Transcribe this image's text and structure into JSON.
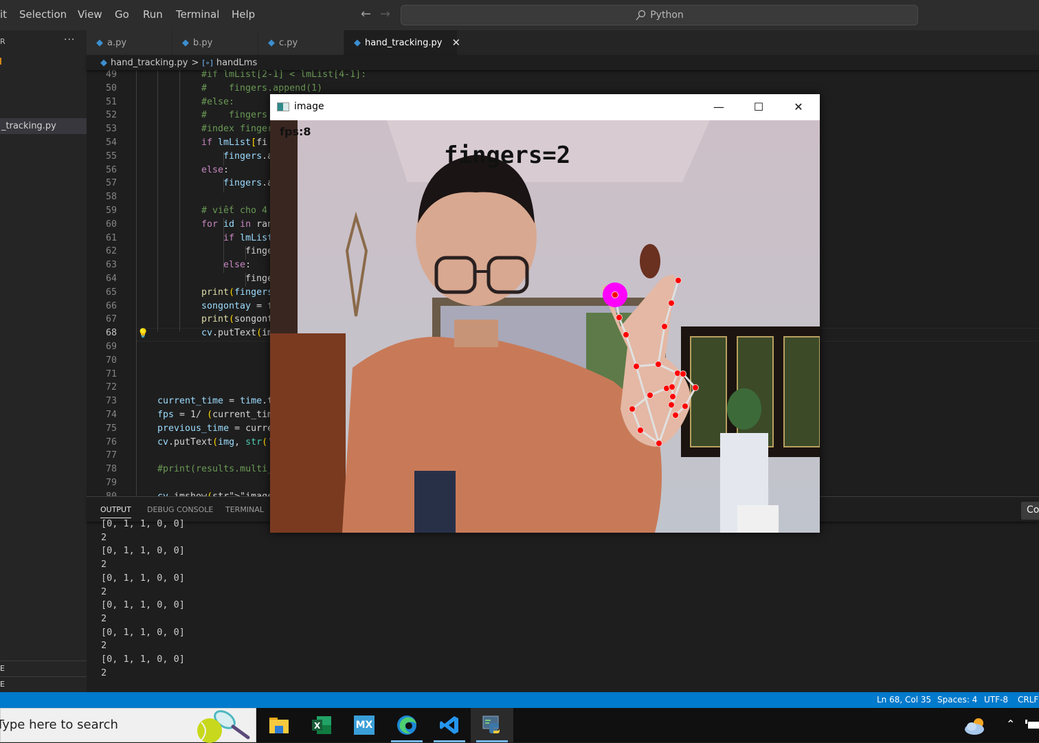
{
  "menu": {
    "items": [
      "it",
      "Selection",
      "View",
      "Go",
      "Run",
      "Terminal",
      "Help"
    ],
    "command_center": "Python"
  },
  "sidebar": {
    "header": "R",
    "more": "···",
    "active_file": "_tracking.py",
    "sections": [
      "E",
      "E"
    ]
  },
  "tabs": [
    {
      "label": "a.py",
      "active": false
    },
    {
      "label": "b.py",
      "active": false
    },
    {
      "label": "c.py",
      "active": false
    },
    {
      "label": "hand_tracking.py",
      "active": true
    }
  ],
  "tab_close": "✕",
  "breadcrumb": {
    "file": "hand_tracking.py",
    "separator": ">",
    "symbol_icon": "[∘]",
    "symbol": "handLms"
  },
  "editor": {
    "current_line": 68,
    "lines": [
      {
        "n": "49",
        "t": "#if lmList[2-1] < lmList[4-1]:"
      },
      {
        "n": "50",
        "t": "#    fingers.append(1)"
      },
      {
        "n": "51",
        "t": "#else:"
      },
      {
        "n": "52",
        "t": "#    fingers"
      },
      {
        "n": "53",
        "t": "#index finger"
      },
      {
        "n": "54",
        "t": "if lmList[fi"
      },
      {
        "n": "55",
        "t": "    fingers.a"
      },
      {
        "n": "56",
        "t": "else:"
      },
      {
        "n": "57",
        "t": "    fingers.a"
      },
      {
        "n": "58",
        "t": ""
      },
      {
        "n": "59",
        "t": "# viết cho 4"
      },
      {
        "n": "60",
        "t": "for id in ran"
      },
      {
        "n": "61",
        "t": "    if lmList"
      },
      {
        "n": "62",
        "t": "        finge"
      },
      {
        "n": "63",
        "t": "    else:"
      },
      {
        "n": "64",
        "t": "        finge"
      },
      {
        "n": "65",
        "t": "print(fingers"
      },
      {
        "n": "66",
        "t": "songontay = f"
      },
      {
        "n": "67",
        "t": "print(songont"
      },
      {
        "n": "68",
        "t": "cv.putText(im"
      },
      {
        "n": "69",
        "t": ""
      },
      {
        "n": "70",
        "t": ""
      },
      {
        "n": "71",
        "t": ""
      },
      {
        "n": "72",
        "t": ""
      },
      {
        "n": "73",
        "t": "current_time = time.t"
      },
      {
        "n": "74",
        "t": "fps = 1/ (current_tim"
      },
      {
        "n": "75",
        "t": "previous_time = curre"
      },
      {
        "n": "76",
        "t": "cv.putText(img, str('"
      },
      {
        "n": "77",
        "t": ""
      },
      {
        "n": "78",
        "t": "#print(results.multi_"
      },
      {
        "n": "79",
        "t": ""
      },
      {
        "n": "80",
        "t": "cv.imshow(\"image\", im"
      }
    ]
  },
  "panel": {
    "tabs": [
      "OUTPUT",
      "DEBUG CONSOLE",
      "TERMINAL"
    ],
    "active_tab": "OUTPUT",
    "dropdown": "Co",
    "output_lines": [
      "[0, 1, 1, 0, 0]",
      "2",
      "[0, 1, 1, 0, 0]",
      "2",
      "[0, 1, 1, 0, 0]",
      "2",
      "[0, 1, 1, 0, 0]",
      "2",
      "[0, 1, 1, 0, 0]",
      "2",
      "[0, 1, 1, 0, 0]",
      "2"
    ]
  },
  "statusbar": {
    "position": "Ln 68, Col 35",
    "spaces": "Spaces: 4",
    "encoding": "UTF-8",
    "eol": "CRLF"
  },
  "taskbar": {
    "search_placeholder": "Type here to search",
    "apps": [
      "file-explorer",
      "excel",
      "mx",
      "edge",
      "vscode",
      "python"
    ],
    "mx_label": "MX"
  },
  "cv_window": {
    "title": "image",
    "minimize": "—",
    "maximize": "☐",
    "close": "✕",
    "fps_text": "fps:8",
    "fingers_text": "fingers=2",
    "finger_states": [
      0,
      1,
      1,
      0,
      0
    ],
    "finger_count": 2
  },
  "colors": {
    "accent": "#007acc",
    "landmark": "#ff0000",
    "highlight": "#ff00ff",
    "connection": "#e0e0e0"
  }
}
